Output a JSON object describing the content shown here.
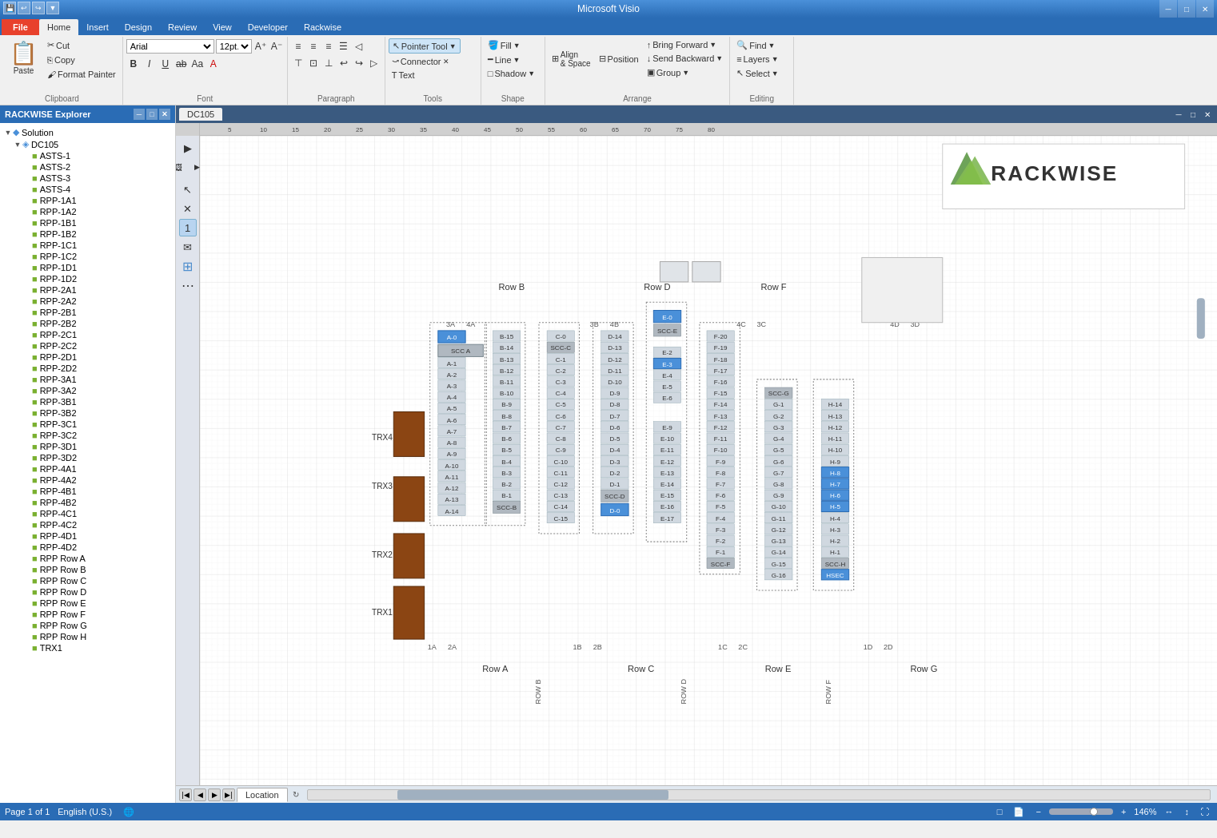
{
  "app": {
    "title": "Microsoft Visio",
    "window_controls": [
      "─",
      "□",
      "✕"
    ]
  },
  "quick_access": [
    "💾",
    "↩",
    "↪",
    "▼"
  ],
  "ribbon_tabs": [
    {
      "label": "File",
      "active": false,
      "file": true
    },
    {
      "label": "Home",
      "active": true
    },
    {
      "label": "Insert",
      "active": false
    },
    {
      "label": "Design",
      "active": false
    },
    {
      "label": "Review",
      "active": false
    },
    {
      "label": "View",
      "active": false
    },
    {
      "label": "Developer",
      "active": false
    },
    {
      "label": "Rackwise",
      "active": false
    }
  ],
  "ribbon": {
    "clipboard": {
      "label": "Clipboard",
      "paste": "Paste",
      "cut": "Cut",
      "copy": "Copy",
      "format_painter": "Format Painter"
    },
    "font": {
      "label": "Font",
      "name": "Arial",
      "size": "12pt.",
      "bold": "B",
      "italic": "I",
      "underline": "U",
      "strikethrough": "ab",
      "case": "Aa",
      "color": "A"
    },
    "paragraph": {
      "label": "Paragraph"
    },
    "tools": {
      "label": "Tools",
      "pointer": "Pointer Tool",
      "connector": "Connector",
      "text": "Text"
    },
    "shape": {
      "label": "Shape",
      "fill": "Fill",
      "line": "Line",
      "shadow": "Shadow"
    },
    "arrange": {
      "label": "Arrange",
      "align": "Align & Space",
      "position": "Position",
      "bring_forward": "Bring Forward",
      "send_backward": "Send Backward",
      "group": "Group"
    },
    "editing": {
      "label": "Editing",
      "find": "Find",
      "layers": "Layers",
      "select": "Select"
    }
  },
  "left_panel": {
    "title": "RACKWISE Explorer",
    "tree": [
      {
        "level": 0,
        "label": "Solution",
        "icon": "solution",
        "expanded": true,
        "arrow": "▼"
      },
      {
        "level": 1,
        "label": "DC105",
        "icon": "dc",
        "expanded": true,
        "arrow": "▼"
      },
      {
        "level": 2,
        "label": "ASTS-1",
        "icon": "item",
        "expanded": false,
        "arrow": ""
      },
      {
        "level": 2,
        "label": "ASTS-2",
        "icon": "item",
        "expanded": false,
        "arrow": ""
      },
      {
        "level": 2,
        "label": "ASTS-3",
        "icon": "item",
        "expanded": false,
        "arrow": ""
      },
      {
        "level": 2,
        "label": "ASTS-4",
        "icon": "item",
        "expanded": false,
        "arrow": ""
      },
      {
        "level": 2,
        "label": "RPP-1A1",
        "icon": "item",
        "expanded": false,
        "arrow": ""
      },
      {
        "level": 2,
        "label": "RPP-1A2",
        "icon": "item",
        "expanded": false,
        "arrow": ""
      },
      {
        "level": 2,
        "label": "RPP-1B1",
        "icon": "item",
        "expanded": false,
        "arrow": ""
      },
      {
        "level": 2,
        "label": "RPP-1B2",
        "icon": "item",
        "expanded": false,
        "arrow": ""
      },
      {
        "level": 2,
        "label": "RPP-1C1",
        "icon": "item",
        "expanded": false,
        "arrow": ""
      },
      {
        "level": 2,
        "label": "RPP-1C2",
        "icon": "item",
        "expanded": false,
        "arrow": ""
      },
      {
        "level": 2,
        "label": "RPP-1D1",
        "icon": "item",
        "expanded": false,
        "arrow": ""
      },
      {
        "level": 2,
        "label": "RPP-1D2",
        "icon": "item",
        "expanded": false,
        "arrow": ""
      },
      {
        "level": 2,
        "label": "RPP-2A1",
        "icon": "item",
        "expanded": false,
        "arrow": ""
      },
      {
        "level": 2,
        "label": "RPP-2A2",
        "icon": "item",
        "expanded": false,
        "arrow": ""
      },
      {
        "level": 2,
        "label": "RPP-2B1",
        "icon": "item",
        "expanded": false,
        "arrow": ""
      },
      {
        "level": 2,
        "label": "RPP-2B2",
        "icon": "item",
        "expanded": false,
        "arrow": ""
      },
      {
        "level": 2,
        "label": "RPP-2C1",
        "icon": "item",
        "expanded": false,
        "arrow": ""
      },
      {
        "level": 2,
        "label": "RPP-2C2",
        "icon": "item",
        "expanded": false,
        "arrow": ""
      },
      {
        "level": 2,
        "label": "RPP-2D1",
        "icon": "item",
        "expanded": false,
        "arrow": ""
      },
      {
        "level": 2,
        "label": "RPP-2D2",
        "icon": "item",
        "expanded": false,
        "arrow": ""
      },
      {
        "level": 2,
        "label": "RPP-3A1",
        "icon": "item",
        "expanded": false,
        "arrow": ""
      },
      {
        "level": 2,
        "label": "RPP-3A2",
        "icon": "item",
        "expanded": false,
        "arrow": ""
      },
      {
        "level": 2,
        "label": "RPP-3B1",
        "icon": "item",
        "expanded": false,
        "arrow": ""
      },
      {
        "level": 2,
        "label": "RPP-3B2",
        "icon": "item",
        "expanded": false,
        "arrow": ""
      },
      {
        "level": 2,
        "label": "RPP-3C1",
        "icon": "item",
        "expanded": false,
        "arrow": ""
      },
      {
        "level": 2,
        "label": "RPP-3C2",
        "icon": "item",
        "expanded": false,
        "arrow": ""
      },
      {
        "level": 2,
        "label": "RPP-3D1",
        "icon": "item",
        "expanded": false,
        "arrow": ""
      },
      {
        "level": 2,
        "label": "RPP-3D2",
        "icon": "item",
        "expanded": false,
        "arrow": ""
      },
      {
        "level": 2,
        "label": "RPP-4A1",
        "icon": "item",
        "expanded": false,
        "arrow": ""
      },
      {
        "level": 2,
        "label": "RPP-4A2",
        "icon": "item",
        "expanded": false,
        "arrow": ""
      },
      {
        "level": 2,
        "label": "RPP-4B1",
        "icon": "item",
        "expanded": false,
        "arrow": ""
      },
      {
        "level": 2,
        "label": "RPP-4B2",
        "icon": "item",
        "expanded": false,
        "arrow": ""
      },
      {
        "level": 2,
        "label": "RPP-4C1",
        "icon": "item",
        "expanded": false,
        "arrow": ""
      },
      {
        "level": 2,
        "label": "RPP-4C2",
        "icon": "item",
        "expanded": false,
        "arrow": ""
      },
      {
        "level": 2,
        "label": "RPP-4D1",
        "icon": "item",
        "expanded": false,
        "arrow": ""
      },
      {
        "level": 2,
        "label": "RPP-4D2",
        "icon": "item",
        "expanded": false,
        "arrow": ""
      },
      {
        "level": 2,
        "label": "RPP Row A",
        "icon": "item",
        "expanded": false,
        "arrow": ""
      },
      {
        "level": 2,
        "label": "RPP Row B",
        "icon": "item",
        "expanded": false,
        "arrow": ""
      },
      {
        "level": 2,
        "label": "RPP Row C",
        "icon": "item",
        "expanded": false,
        "arrow": ""
      },
      {
        "level": 2,
        "label": "RPP Row D",
        "icon": "item",
        "expanded": false,
        "arrow": ""
      },
      {
        "level": 2,
        "label": "RPP Row E",
        "icon": "item",
        "expanded": false,
        "arrow": ""
      },
      {
        "level": 2,
        "label": "RPP Row F",
        "icon": "item",
        "expanded": false,
        "arrow": ""
      },
      {
        "level": 2,
        "label": "RPP Row G",
        "icon": "item",
        "expanded": false,
        "arrow": ""
      },
      {
        "level": 2,
        "label": "RPP Row H",
        "icon": "item",
        "expanded": false,
        "arrow": ""
      },
      {
        "level": 2,
        "label": "TRX1",
        "icon": "item",
        "expanded": false,
        "arrow": ""
      }
    ]
  },
  "canvas": {
    "tab": "DC105",
    "page_tab": "Location",
    "diagram_title": "DC105"
  },
  "status_bar": {
    "page": "Page 1 of 1",
    "language": "English (U.S.)",
    "zoom": "146%"
  },
  "tools": [
    {
      "name": "expand-right",
      "icon": "▶"
    },
    {
      "name": "pointer",
      "icon": "↖"
    },
    {
      "name": "cross",
      "icon": "✕"
    },
    {
      "name": "number-1",
      "icon": "1"
    },
    {
      "name": "envelope",
      "icon": "✉"
    },
    {
      "name": "grid",
      "icon": "⊞"
    },
    {
      "name": "dotted-grid",
      "icon": "⋯"
    }
  ]
}
